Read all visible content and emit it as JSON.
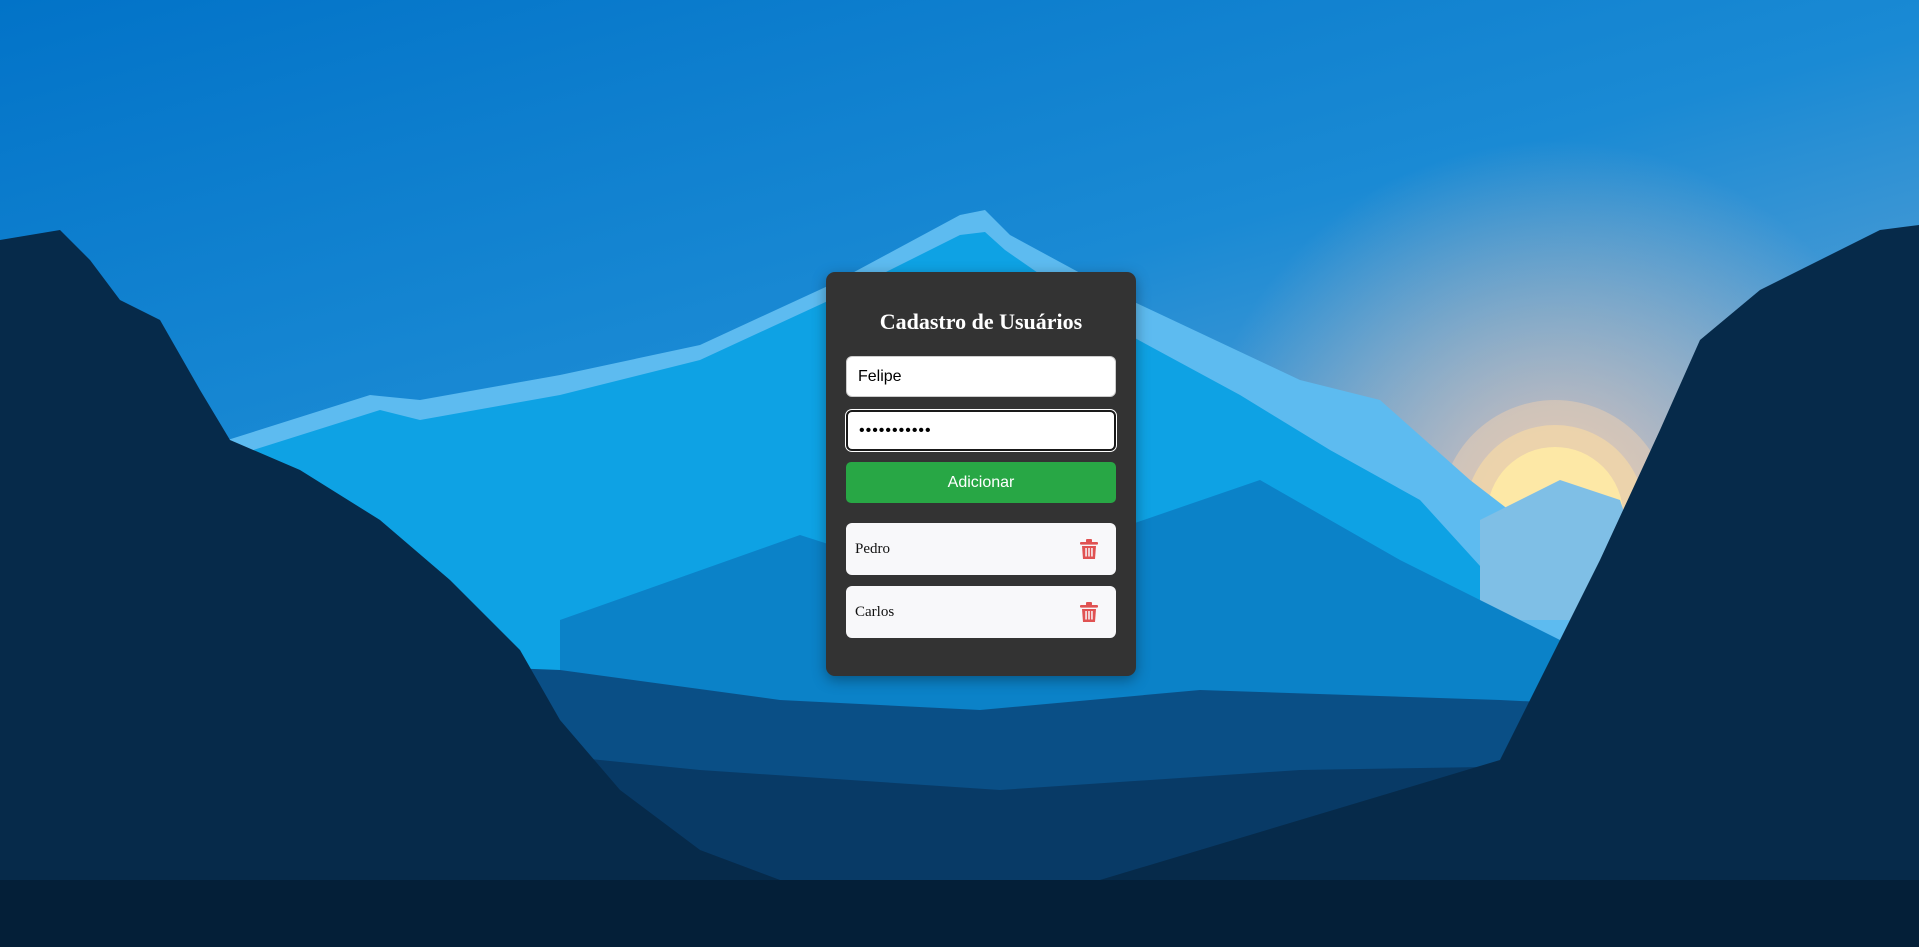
{
  "app": {
    "title": "Cadastro de Usuários"
  },
  "form": {
    "name_value": "Felipe",
    "password_value": "***********",
    "add_label": "Adicionar"
  },
  "users": [
    {
      "name": "Pedro"
    },
    {
      "name": "Carlos"
    }
  ],
  "colors": {
    "card_bg": "#333333",
    "add_button": "#28a745",
    "delete_icon": "#e05252",
    "item_bg": "#f8f8fa"
  },
  "icons": {
    "delete": "trash-icon"
  }
}
